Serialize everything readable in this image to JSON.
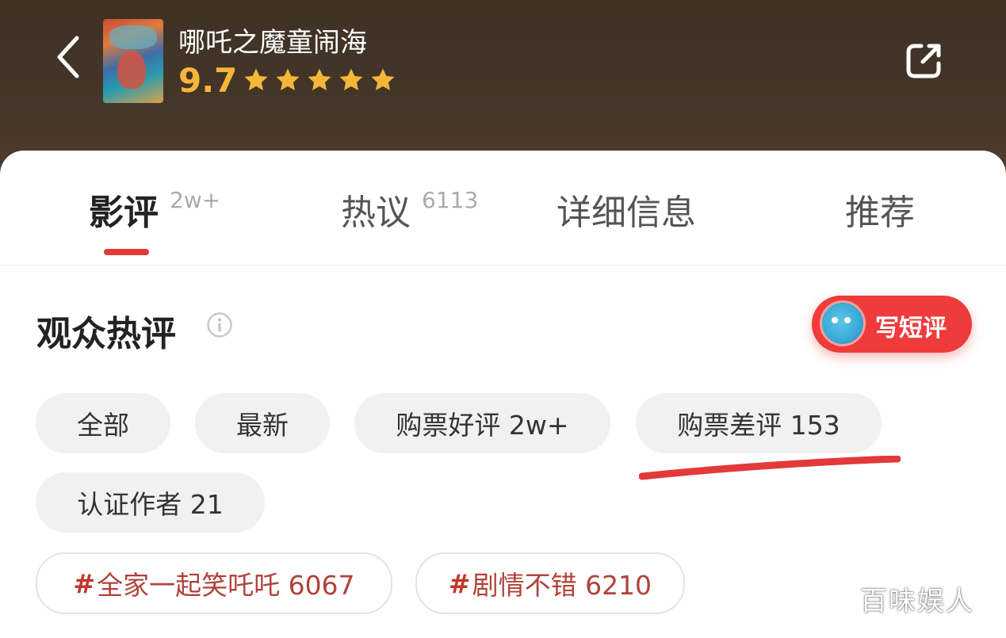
{
  "header": {
    "movie_title": "哪吒之魔童闹海",
    "score": "9.7",
    "stars_filled": 5,
    "star_color": "#f5b63a"
  },
  "tabs": [
    {
      "label": "影评",
      "count": "2w+",
      "active": true
    },
    {
      "label": "热议",
      "count": "6113",
      "active": false
    },
    {
      "label": "详细信息",
      "count": "",
      "active": false
    },
    {
      "label": "推荐",
      "count": "",
      "active": false
    }
  ],
  "section": {
    "title": "观众热评",
    "write_button_label": "写短评"
  },
  "filters": [
    {
      "label": "全部"
    },
    {
      "label": "最新"
    },
    {
      "label": "购票好评 2w+"
    },
    {
      "label": "购票差评 153"
    },
    {
      "label": "认证作者 21"
    }
  ],
  "topics": [
    {
      "hash": "#",
      "label": "全家一起笑吒吒 6067"
    },
    {
      "hash": "#",
      "label": "剧情不错 6210"
    }
  ],
  "watermark": "百味娱人",
  "colors": {
    "accent_red": "#e53935",
    "header_bg": "#3e3124"
  }
}
